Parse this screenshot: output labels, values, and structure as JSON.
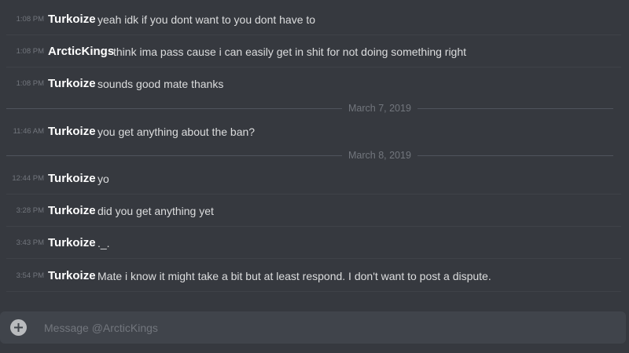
{
  "messages": [
    {
      "time": "1:08 PM",
      "author": "Turkoize",
      "text": "yeah idk if you dont want to you dont have to"
    },
    {
      "time": "1:08 PM",
      "author": "ArcticKings",
      "text": "think ima pass cause i can easily get in shit for not doing something right"
    },
    {
      "time": "1:08 PM",
      "author": "Turkoize",
      "text": "sounds good mate thanks"
    },
    {
      "time": "11:46 AM",
      "author": "Turkoize",
      "text": "you get anything about the ban?"
    },
    {
      "time": "12:44 PM",
      "author": "Turkoize",
      "text": "yo"
    },
    {
      "time": "3:28 PM",
      "author": "Turkoize",
      "text": "did you get anything yet"
    },
    {
      "time": "3:43 PM",
      "author": "Turkoize",
      "text": "._."
    },
    {
      "time": "3:54 PM",
      "author": "Turkoize",
      "text": "Mate i know it might take a bit but at least respond. I don't want to post a dispute."
    }
  ],
  "date_dividers": [
    "March 7, 2019",
    "March 8, 2019"
  ],
  "composer": {
    "placeholder": "Message @ArcticKings",
    "attach_icon": "plus-circle-icon"
  },
  "colors": {
    "background": "#36393f",
    "composer_background": "#40444b",
    "username": "#ffffff",
    "message_text": "#dcddde",
    "muted": "#72767d"
  }
}
